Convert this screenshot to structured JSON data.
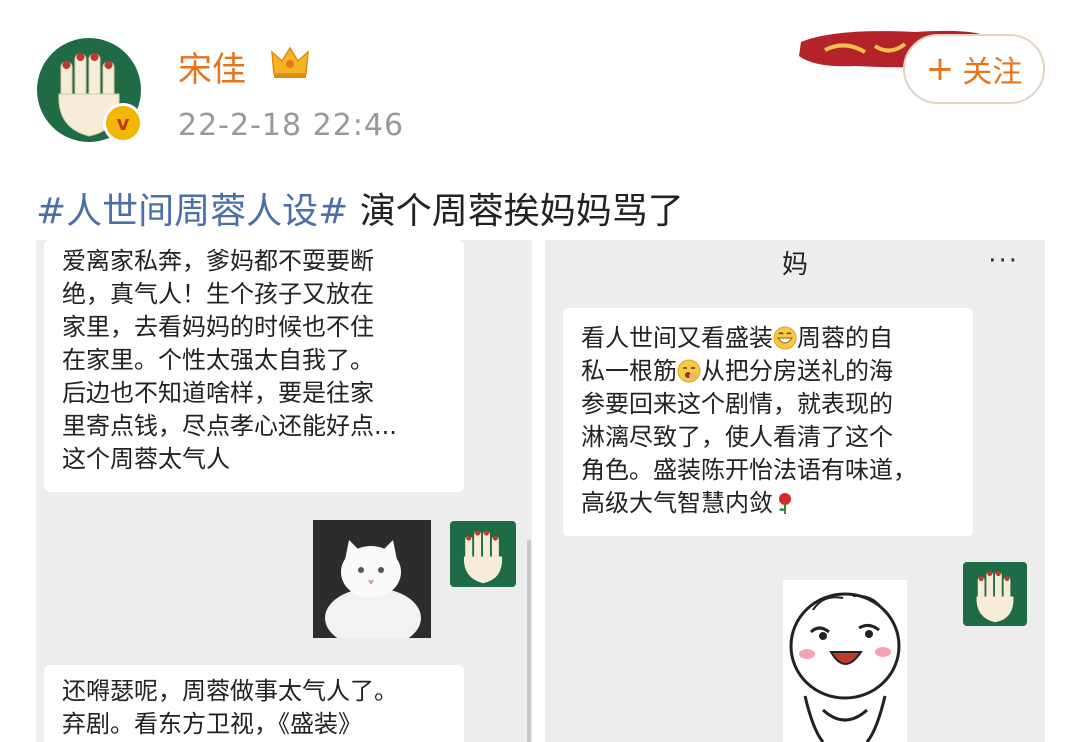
{
  "post": {
    "username": "宋佳",
    "timestamp": "22-2-18 22:46",
    "verified_mark": "v",
    "follow_plus": "+",
    "follow_label": "关注",
    "hashtag": "#人世间周蓉人设#",
    "body": " 演个周蓉挨妈妈骂了"
  },
  "left_chat": {
    "message1": [
      "爱离家私奔，爹妈都不耍要断",
      "绝，真气人！生个孩子又放在",
      "家里，去看妈妈的时候也不住",
      "在家里。个性太强太自我了。",
      "后边也不知道啥样，要是往家",
      "里寄点钱，尽点孝心还能好点...",
      "这个周蓉太气人"
    ],
    "message2": [
      "还嘚瑟呢，周蓉做事太气人了。",
      "弃剧。看东方卫视，《盛装》"
    ]
  },
  "right_chat": {
    "title": "妈",
    "more": "···",
    "message_parts": {
      "l1a": "看人世间又看盛装",
      "l1b": "周蓉的自",
      "l2a": "私一根筋",
      "l2b": "从把分房送礼的海",
      "l3": "参要回来这个剧情，就表现的",
      "l4": "淋漓尽致了，使人看清了这个",
      "l5": "角色。盛装陈开怡法语有味道，",
      "l6": "高级大气智慧内敛"
    }
  },
  "icons": {
    "avatar": "hand-avatar-icon",
    "crown": "crown-icon",
    "banner": "brush-banner-icon",
    "emoji1": "grin-emoji-icon",
    "emoji2": "yawn-emoji-icon",
    "emoji3": "rose-emoji-icon",
    "more": "more-dots-icon"
  },
  "colors": {
    "username": "#e8731c",
    "hashtag": "#4b6fa8",
    "avatar_bg": "#1f6b45",
    "verified_bg": "#f2b705"
  }
}
